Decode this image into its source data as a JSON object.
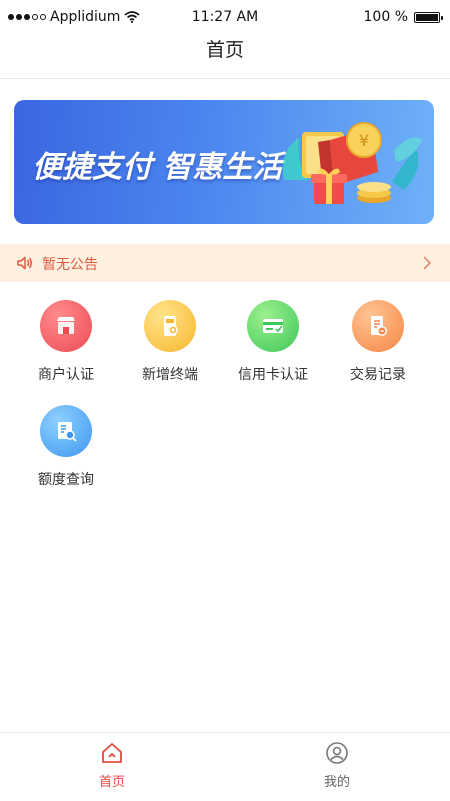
{
  "status": {
    "carrier": "Applidium",
    "time": "11:27 AM",
    "battery": "100 %",
    "battery_level": 1.0
  },
  "header": {
    "title": "首页"
  },
  "banner": {
    "text": "便捷支付 智惠生活"
  },
  "notice": {
    "text": "暂无公告"
  },
  "features": [
    {
      "label": "商户认证",
      "icon": "store-icon",
      "color": "#ed4b56"
    },
    {
      "label": "新增终端",
      "icon": "terminal-icon",
      "color": "#f7b62d"
    },
    {
      "label": "信用卡认证",
      "icon": "credit-card-icon",
      "color": "#3ec75a"
    },
    {
      "label": "交易记录",
      "icon": "transaction-record-icon",
      "color": "#f58644"
    },
    {
      "label": "额度查询",
      "icon": "quota-search-icon",
      "color": "#3c97ef"
    }
  ],
  "tabs": [
    {
      "label": "首页",
      "icon": "home-icon",
      "active": true
    },
    {
      "label": "我的",
      "icon": "profile-icon",
      "active": false
    }
  ],
  "colors": {
    "accent": "#e8493f",
    "notice_bg": "#fdf0e1",
    "banner_blue": "#4b86ef"
  }
}
